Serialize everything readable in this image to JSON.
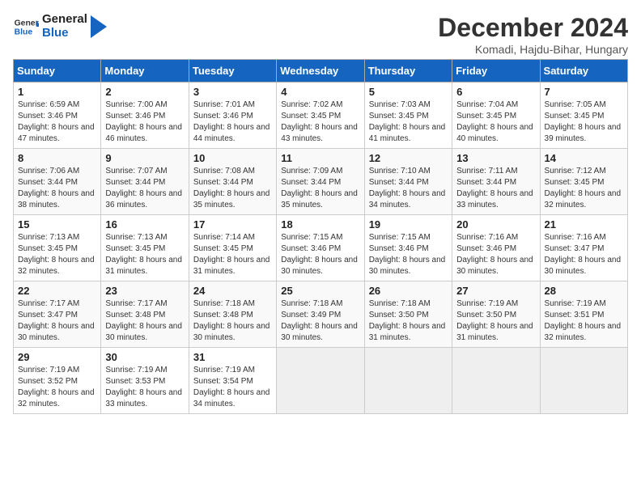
{
  "header": {
    "logo_line1": "General",
    "logo_line2": "Blue",
    "title": "December 2024",
    "subtitle": "Komadi, Hajdu-Bihar, Hungary"
  },
  "columns": [
    "Sunday",
    "Monday",
    "Tuesday",
    "Wednesday",
    "Thursday",
    "Friday",
    "Saturday"
  ],
  "weeks": [
    [
      {
        "day": "1",
        "sunrise": "6:59 AM",
        "sunset": "3:46 PM",
        "daylight": "8 hours and 47 minutes."
      },
      {
        "day": "2",
        "sunrise": "7:00 AM",
        "sunset": "3:46 PM",
        "daylight": "8 hours and 46 minutes."
      },
      {
        "day": "3",
        "sunrise": "7:01 AM",
        "sunset": "3:46 PM",
        "daylight": "8 hours and 44 minutes."
      },
      {
        "day": "4",
        "sunrise": "7:02 AM",
        "sunset": "3:45 PM",
        "daylight": "8 hours and 43 minutes."
      },
      {
        "day": "5",
        "sunrise": "7:03 AM",
        "sunset": "3:45 PM",
        "daylight": "8 hours and 41 minutes."
      },
      {
        "day": "6",
        "sunrise": "7:04 AM",
        "sunset": "3:45 PM",
        "daylight": "8 hours and 40 minutes."
      },
      {
        "day": "7",
        "sunrise": "7:05 AM",
        "sunset": "3:45 PM",
        "daylight": "8 hours and 39 minutes."
      }
    ],
    [
      {
        "day": "8",
        "sunrise": "7:06 AM",
        "sunset": "3:44 PM",
        "daylight": "8 hours and 38 minutes."
      },
      {
        "day": "9",
        "sunrise": "7:07 AM",
        "sunset": "3:44 PM",
        "daylight": "8 hours and 36 minutes."
      },
      {
        "day": "10",
        "sunrise": "7:08 AM",
        "sunset": "3:44 PM",
        "daylight": "8 hours and 35 minutes."
      },
      {
        "day": "11",
        "sunrise": "7:09 AM",
        "sunset": "3:44 PM",
        "daylight": "8 hours and 35 minutes."
      },
      {
        "day": "12",
        "sunrise": "7:10 AM",
        "sunset": "3:44 PM",
        "daylight": "8 hours and 34 minutes."
      },
      {
        "day": "13",
        "sunrise": "7:11 AM",
        "sunset": "3:44 PM",
        "daylight": "8 hours and 33 minutes."
      },
      {
        "day": "14",
        "sunrise": "7:12 AM",
        "sunset": "3:45 PM",
        "daylight": "8 hours and 32 minutes."
      }
    ],
    [
      {
        "day": "15",
        "sunrise": "7:13 AM",
        "sunset": "3:45 PM",
        "daylight": "8 hours and 32 minutes."
      },
      {
        "day": "16",
        "sunrise": "7:13 AM",
        "sunset": "3:45 PM",
        "daylight": "8 hours and 31 minutes."
      },
      {
        "day": "17",
        "sunrise": "7:14 AM",
        "sunset": "3:45 PM",
        "daylight": "8 hours and 31 minutes."
      },
      {
        "day": "18",
        "sunrise": "7:15 AM",
        "sunset": "3:46 PM",
        "daylight": "8 hours and 30 minutes."
      },
      {
        "day": "19",
        "sunrise": "7:15 AM",
        "sunset": "3:46 PM",
        "daylight": "8 hours and 30 minutes."
      },
      {
        "day": "20",
        "sunrise": "7:16 AM",
        "sunset": "3:46 PM",
        "daylight": "8 hours and 30 minutes."
      },
      {
        "day": "21",
        "sunrise": "7:16 AM",
        "sunset": "3:47 PM",
        "daylight": "8 hours and 30 minutes."
      }
    ],
    [
      {
        "day": "22",
        "sunrise": "7:17 AM",
        "sunset": "3:47 PM",
        "daylight": "8 hours and 30 minutes."
      },
      {
        "day": "23",
        "sunrise": "7:17 AM",
        "sunset": "3:48 PM",
        "daylight": "8 hours and 30 minutes."
      },
      {
        "day": "24",
        "sunrise": "7:18 AM",
        "sunset": "3:48 PM",
        "daylight": "8 hours and 30 minutes."
      },
      {
        "day": "25",
        "sunrise": "7:18 AM",
        "sunset": "3:49 PM",
        "daylight": "8 hours and 30 minutes."
      },
      {
        "day": "26",
        "sunrise": "7:18 AM",
        "sunset": "3:50 PM",
        "daylight": "8 hours and 31 minutes."
      },
      {
        "day": "27",
        "sunrise": "7:19 AM",
        "sunset": "3:50 PM",
        "daylight": "8 hours and 31 minutes."
      },
      {
        "day": "28",
        "sunrise": "7:19 AM",
        "sunset": "3:51 PM",
        "daylight": "8 hours and 32 minutes."
      }
    ],
    [
      {
        "day": "29",
        "sunrise": "7:19 AM",
        "sunset": "3:52 PM",
        "daylight": "8 hours and 32 minutes."
      },
      {
        "day": "30",
        "sunrise": "7:19 AM",
        "sunset": "3:53 PM",
        "daylight": "8 hours and 33 minutes."
      },
      {
        "day": "31",
        "sunrise": "7:19 AM",
        "sunset": "3:54 PM",
        "daylight": "8 hours and 34 minutes."
      },
      null,
      null,
      null,
      null
    ]
  ]
}
